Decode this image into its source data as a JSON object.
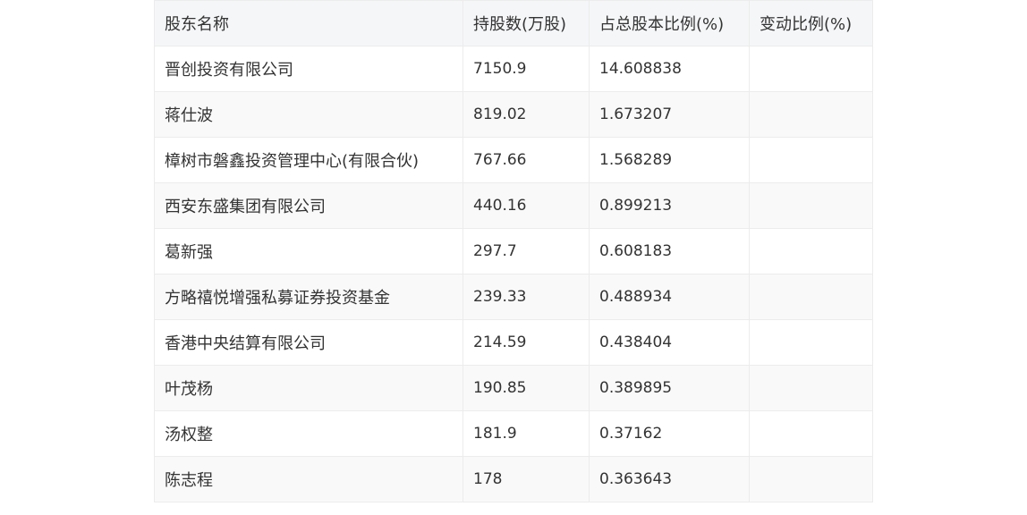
{
  "table": {
    "headers": [
      "股东名称",
      "持股数(万股)",
      "占总股本比例(%)",
      "变动比例(%)"
    ],
    "rows": [
      [
        "晋创投资有限公司",
        "7150.9",
        "14.608838",
        ""
      ],
      [
        "蒋仕波",
        "819.02",
        "1.673207",
        ""
      ],
      [
        "樟树市磐鑫投资管理中心(有限合伙)",
        "767.66",
        "1.568289",
        ""
      ],
      [
        "西安东盛集团有限公司",
        "440.16",
        "0.899213",
        ""
      ],
      [
        "葛新强",
        "297.7",
        "0.608183",
        ""
      ],
      [
        "方略禧悦增强私募证券投资基金",
        "239.33",
        "0.488934",
        ""
      ],
      [
        "香港中央结算有限公司",
        "214.59",
        "0.438404",
        ""
      ],
      [
        "叶茂杨",
        "190.85",
        "0.389895",
        ""
      ],
      [
        "汤权整",
        "181.9",
        "0.37162",
        ""
      ],
      [
        "陈志程",
        "178",
        "0.363643",
        ""
      ]
    ]
  }
}
